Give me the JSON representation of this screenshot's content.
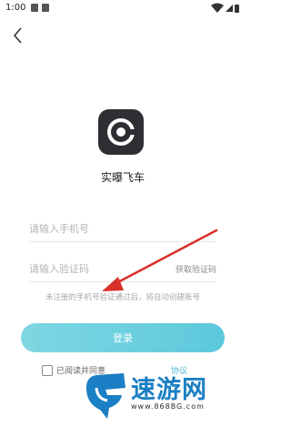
{
  "status_bar": {
    "time": "1:00"
  },
  "app": {
    "name": "实曝飞车"
  },
  "phone_field": {
    "placeholder": "请输入手机号"
  },
  "code_field": {
    "placeholder": "请输入验证码",
    "get_code_label": "获取验证码"
  },
  "hint": "未注册的手机号验证通过后，将自动创建账号",
  "login_button": {
    "label": "登录"
  },
  "agreement": {
    "text": "已阅读并同意",
    "link": "协议"
  },
  "watermark": {
    "name": "速游网",
    "url": "www.868BG.com"
  },
  "colors": {
    "accent": "#5cc8db",
    "arrow": "#d9302a",
    "watermark": "#1a7fc4"
  },
  "icons": {
    "back": "chevron-left-icon",
    "logo": "app-logo-icon",
    "wifi": "wifi-icon",
    "battery": "battery-icon"
  }
}
